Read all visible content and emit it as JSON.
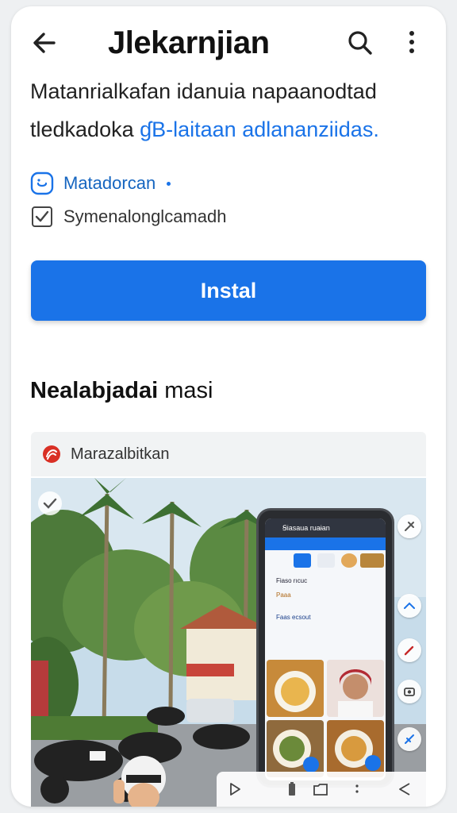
{
  "appbar": {
    "title": "Jlekarnjian"
  },
  "description": {
    "line1": "Matanrialkafan idanuia napaanodtad",
    "line2_prefix": "tledkadoka ",
    "line2_link": "ɠB-laitaan adlananziidas."
  },
  "developer": {
    "name": "Matadorcan"
  },
  "checkbox": {
    "label": "Symenalonglcamadh"
  },
  "install": {
    "label": "Instal"
  },
  "section": {
    "heading_bold": "Nealabjadai",
    "heading_light": "masi"
  },
  "ad": {
    "label": "Marazalbitkan"
  },
  "phone_screen": {
    "header": "Ꞩiasaua ruaɨan",
    "text1": "Fiaso rıcuc",
    "text2": "Paaa",
    "text3": "Faas ecsout"
  },
  "colors": {
    "accent": "#1a73e8",
    "ad_icon": "#d93025"
  }
}
